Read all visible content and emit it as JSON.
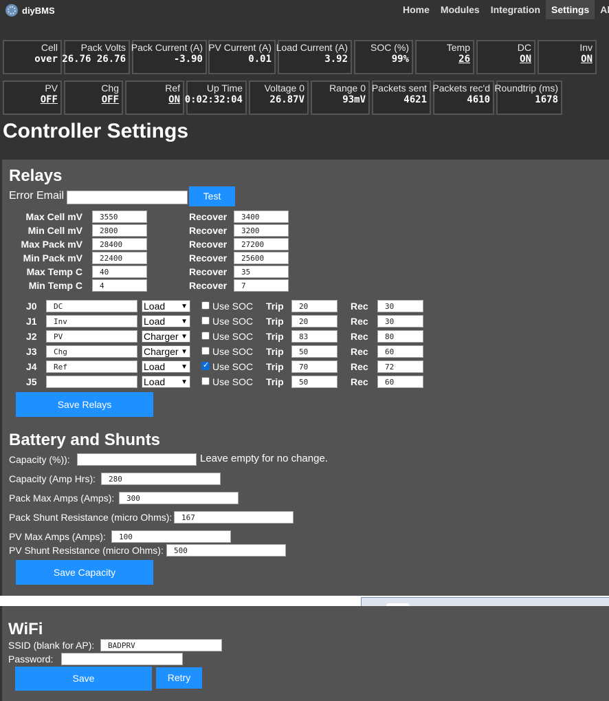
{
  "brand": {
    "name": "diyBMS",
    "logo_icon": "diybms-logo-icon"
  },
  "nav": {
    "items": [
      {
        "label": "Home",
        "active": false
      },
      {
        "label": "Modules",
        "active": false
      },
      {
        "label": "Integration",
        "active": false
      },
      {
        "label": "Settings",
        "active": true
      },
      {
        "label": "Al",
        "active": false
      }
    ]
  },
  "tiles": {
    "cell": {
      "title": "Cell",
      "value": "over"
    },
    "pack_volts": {
      "title": "Pack Volts",
      "value": "26.76 26.76"
    },
    "pack_current": {
      "title": "Pack Current (A)",
      "value": "-3.90"
    },
    "pv_current": {
      "title": "PV Current (A)",
      "value": "0.01"
    },
    "load_current": {
      "title": "Load Current (A)",
      "value": "3.92"
    },
    "soc": {
      "title": "SOC (%)",
      "value": "99%"
    },
    "temp": {
      "title": "Temp",
      "value": "26"
    },
    "dc": {
      "title": "DC",
      "value": "ON"
    },
    "inv": {
      "title": "Inv",
      "value": "ON"
    },
    "pv": {
      "title": "PV",
      "value": "OFF"
    },
    "chg": {
      "title": "Chg",
      "value": "OFF"
    },
    "ref": {
      "title": "Ref",
      "value": "ON"
    },
    "uptime": {
      "title": "Up Time",
      "value": "0:02:32:04"
    },
    "voltage0": {
      "title": "Voltage 0",
      "value": "26.87V"
    },
    "range0": {
      "title": "Range 0",
      "value": "93mV"
    },
    "packets_sent": {
      "title": "Packets sent",
      "value": "4621"
    },
    "packets_recd": {
      "title": "Packets rec'd",
      "value": "4610"
    },
    "roundtrip": {
      "title": "Roundtrip (ms)",
      "value": "1678"
    }
  },
  "page_title": "Controller Settings",
  "relays": {
    "heading": "Relays",
    "error_email_label": "Error Email",
    "error_email_value": "",
    "test_label": "Test",
    "recover_label": "Recover",
    "thresholds": [
      {
        "label": "Max Cell mV",
        "value": "3550",
        "recover": "3400"
      },
      {
        "label": "Min Cell mV",
        "value": "2800",
        "recover": "3200"
      },
      {
        "label": "Max Pack mV",
        "value": "28400",
        "recover": "27200"
      },
      {
        "label": "Min Pack mV",
        "value": "22400",
        "recover": "25600"
      },
      {
        "label": "Max Temp C",
        "value": "40",
        "recover": "35"
      },
      {
        "label": "Min Temp C",
        "value": "4",
        "recover": "7"
      }
    ],
    "use_soc_label": "Use SOC",
    "trip_label": "Trip",
    "rec_label": "Rec",
    "rows": [
      {
        "id": "J0",
        "name": "DC",
        "type": "Load",
        "use_soc": false,
        "trip": "20",
        "rec": "30"
      },
      {
        "id": "J1",
        "name": "Inv",
        "type": "Load",
        "use_soc": false,
        "trip": "20",
        "rec": "30"
      },
      {
        "id": "J2",
        "name": "PV",
        "type": "Charger",
        "use_soc": false,
        "trip": "83",
        "rec": "80"
      },
      {
        "id": "J3",
        "name": "Chg",
        "type": "Charger",
        "use_soc": false,
        "trip": "50",
        "rec": "60"
      },
      {
        "id": "J4",
        "name": "Ref",
        "type": "Load",
        "use_soc": true,
        "trip": "70",
        "rec": "72"
      },
      {
        "id": "J5",
        "name": "",
        "type": "Load",
        "use_soc": false,
        "trip": "50",
        "rec": "60"
      }
    ],
    "save_label": "Save Relays"
  },
  "battery": {
    "heading": "Battery and Shunts",
    "capacity_pct_label": "Capacity (%)):",
    "capacity_pct_value": "",
    "capacity_hint": "Leave empty for no change.",
    "capacity_ah_label": "Capacity (Amp Hrs):",
    "capacity_ah_value": "280",
    "pack_max_amps_label": "Pack Max Amps (Amps):",
    "pack_max_amps_value": "300",
    "pack_shunt_label": "Pack Shunt Resistance (micro Ohms):",
    "pack_shunt_value": "167",
    "pv_max_amps_label": "PV Max Amps (Amps):",
    "pv_max_amps_value": "100",
    "pv_shunt_label": "PV Shunt Resistance (micro Ohms):",
    "pv_shunt_value": "500",
    "save_label": "Save Capacity"
  },
  "wifi": {
    "heading": "WiFi",
    "ssid_label": "SSID (blank for AP):",
    "ssid_value": "BADPRV",
    "password_label": "Password:",
    "password_value": "",
    "save_label": "Save",
    "retry_label": "Retry"
  },
  "colors": {
    "background": "#333333",
    "panel": "#535353",
    "button": "#1e90ff",
    "tile_border": "#555555"
  }
}
